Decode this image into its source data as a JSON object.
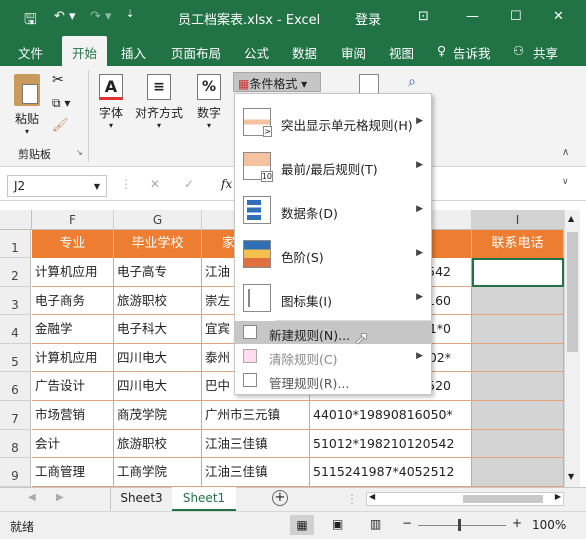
{
  "titlebar": {
    "title": "员工档案表.xlsx - Excel",
    "login": "登录"
  },
  "tabs": [
    "文件",
    "开始",
    "插入",
    "页面布局",
    "公式",
    "数据",
    "审阅",
    "视图"
  ],
  "tell_me": "告诉我",
  "share": "共享",
  "ribbon": {
    "paste": "粘贴",
    "font": "字体",
    "align": "对齐方式",
    "number": "数字",
    "number_sym": "%",
    "cond_format": "条件格式",
    "clipboard": "剪贴板",
    "font_letter": "A"
  },
  "namebox": "J2",
  "fx": "fx",
  "columns": [
    "F",
    "G",
    "",
    "",
    "",
    "",
    "I"
  ],
  "headers": {
    "major": "专业",
    "school": "毕业学校",
    "home": "家",
    "contact": "联系电话"
  },
  "rows": [
    {
      "num": "2",
      "major": "计算机应用",
      "school": "电子高专",
      "home": "江油",
      "id": "542"
    },
    {
      "num": "3",
      "major": "电子商务",
      "school": "旅游职校",
      "home": "崇左",
      "id": "160"
    },
    {
      "num": "4",
      "major": "金融学",
      "school": "电子科大",
      "home": "宜宾",
      "id": "1*0"
    },
    {
      "num": "5",
      "major": "计算机应用",
      "school": "四川电大",
      "home": "泰州",
      "id": "02*"
    },
    {
      "num": "6",
      "major": "广告设计",
      "school": "四川电大",
      "home": "巴中",
      "id": "520"
    },
    {
      "num": "7",
      "major": "市场营销",
      "school": "商茂学院",
      "home": "广州市三元镇",
      "id": "44010*19890816050*"
    },
    {
      "num": "8",
      "major": "会计",
      "school": "旅游职校",
      "home": "江油三佳镇",
      "id": "51012*198210120542"
    },
    {
      "num": "9",
      "major": "工商管理",
      "school": "工商学院",
      "home": "江油三佳镇",
      "id": "5115241987*4052512"
    }
  ],
  "row1": "1",
  "menu": {
    "highlight": "突出显示单元格规则(H)",
    "topbottom": "最前/最后规则(T)",
    "databar": "数据条(D)",
    "colorscale": "色阶(S)",
    "iconset": "图标集(I)",
    "newrule": "新建规则(N)...",
    "clearrule": "清除规则(C)",
    "managerule": "管理规则(R)...",
    "icon_num": "10"
  },
  "sheets": [
    "Sheet3",
    "Sheet1"
  ],
  "status": {
    "ready": "就绪",
    "zoom": "100%"
  }
}
